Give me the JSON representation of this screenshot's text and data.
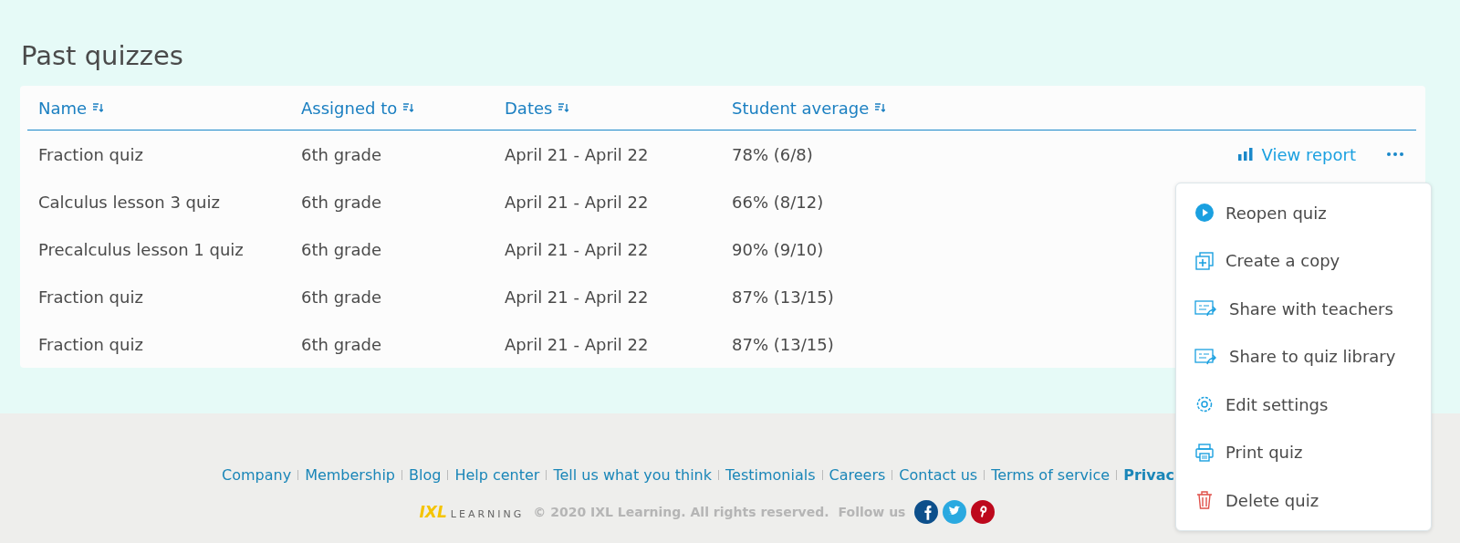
{
  "title": "Past quizzes",
  "table": {
    "columns": [
      "Name",
      "Assigned to",
      "Dates",
      "Student average"
    ],
    "rows": [
      {
        "cells": [
          "Fraction quiz",
          "6th grade",
          "April 21 - April 22",
          "78% (6/8)"
        ],
        "action": "View report"
      },
      {
        "cells": [
          "Calculus lesson 3 quiz",
          "6th grade",
          "April 21 - April 22",
          "66% (8/12)"
        ]
      },
      {
        "cells": [
          "Precalculus lesson 1 quiz",
          "6th grade",
          "April 21 - April 22",
          "90% (9/10)"
        ]
      },
      {
        "cells": [
          "Fraction quiz",
          "6th grade",
          "April 21 - April 22",
          "87% (13/15)"
        ]
      },
      {
        "cells": [
          "Fraction quiz",
          "6th grade",
          "April 21 - April 22",
          "87% (13/15)"
        ]
      }
    ]
  },
  "menu": [
    {
      "label": "Reopen quiz",
      "kind": "play"
    },
    {
      "label": "Create a copy",
      "kind": "copy"
    },
    {
      "label": "Share with teachers",
      "kind": "share"
    },
    {
      "label": "Share to quiz library",
      "kind": "share"
    },
    {
      "label": "Edit settings",
      "kind": "gear"
    },
    {
      "label": "Print quiz",
      "kind": "print"
    },
    {
      "label": "Delete quiz",
      "kind": "trash"
    }
  ],
  "footer": {
    "links": [
      {
        "label": "Company",
        "bold": false
      },
      {
        "label": "Membership",
        "bold": false
      },
      {
        "label": "Blog",
        "bold": false
      },
      {
        "label": "Help center",
        "bold": false
      },
      {
        "label": "Tell us what you think",
        "bold": false
      },
      {
        "label": "Testimonials",
        "bold": false
      },
      {
        "label": "Careers",
        "bold": false
      },
      {
        "label": "Contact us",
        "bold": false
      },
      {
        "label": "Terms of service",
        "bold": false
      },
      {
        "label": "Privac",
        "bold": true
      }
    ],
    "logo": {
      "mark": "IXL",
      "word": "LEARNING"
    },
    "copyright": "© 2020 IXL Learning. All rights reserved.",
    "follow": "Follow us",
    "social": [
      {
        "kind": "facebook",
        "color": "#0d4f8b"
      },
      {
        "kind": "twitter",
        "color": "#2aa9e0"
      },
      {
        "kind": "pinterest",
        "color": "#bd081c"
      }
    ]
  }
}
